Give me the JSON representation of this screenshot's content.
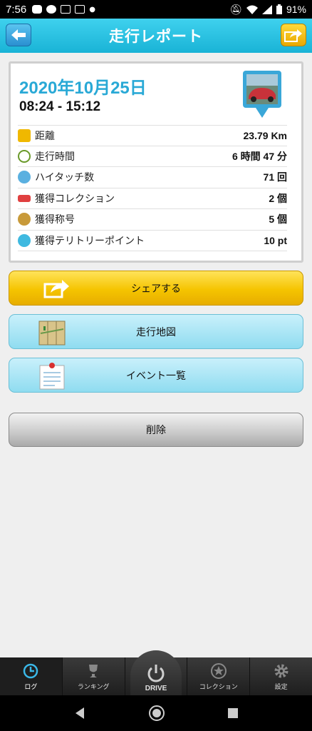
{
  "status_bar": {
    "time": "7:56",
    "battery": "91%"
  },
  "header": {
    "title": "走行レポート"
  },
  "report": {
    "date": "2020年10月25日",
    "time_range": "08:24 - 15:12",
    "stats": [
      {
        "label": "距離",
        "value": "23.79 Km",
        "icon": "km-icon"
      },
      {
        "label": "走行時間",
        "value": "6 時間 47 分",
        "icon": "clock-icon"
      },
      {
        "label": "ハイタッチ数",
        "value": "71 回",
        "icon": "hand-icon"
      },
      {
        "label": "獲得コレクション",
        "value": "2 個",
        "icon": "car-icon"
      },
      {
        "label": "獲得称号",
        "value": "5 個",
        "icon": "medal-icon"
      },
      {
        "label": "獲得テリトリーポイント",
        "value": "10 pt",
        "icon": "territory-icon"
      }
    ]
  },
  "buttons": {
    "share": "シェアする",
    "map": "走行地図",
    "events": "イベント一覧",
    "delete": "削除"
  },
  "bottom_nav": {
    "log": "ログ",
    "ranking": "ランキング",
    "drive": "DRIVE",
    "collection": "コレクション",
    "settings": "設定"
  },
  "colors": {
    "accent": "#29a9d6",
    "share": "#f5c400"
  }
}
